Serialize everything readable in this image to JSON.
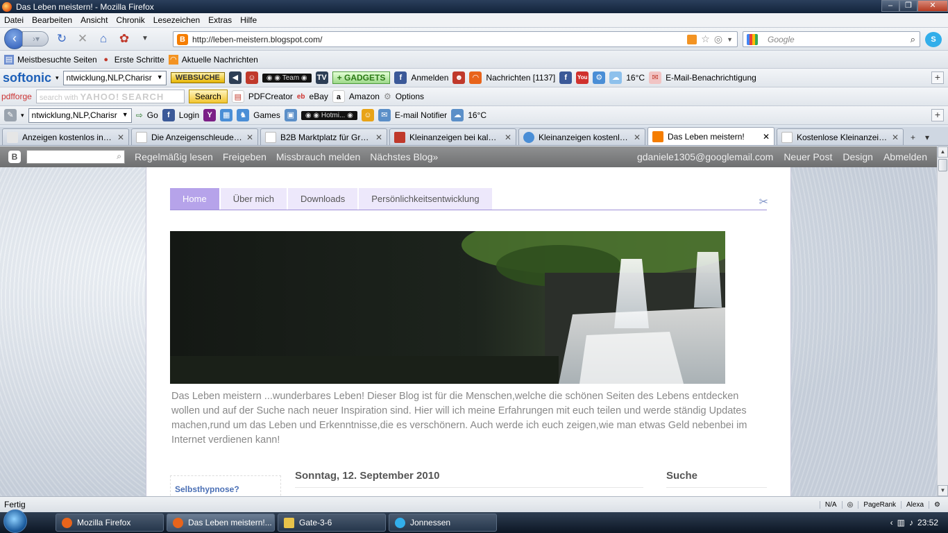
{
  "window": {
    "title": "Das Leben meistern! - Mozilla Firefox"
  },
  "menu": [
    "Datei",
    "Bearbeiten",
    "Ansicht",
    "Chronik",
    "Lesezeichen",
    "Extras",
    "Hilfe"
  ],
  "address": {
    "url": "http://leben-meistern.blogspot.com/"
  },
  "search": {
    "placeholder": "Google"
  },
  "bookmarks": [
    "Meistbesuchte Seiten",
    "Erste Schritte",
    "Aktuelle Nachrichten"
  ],
  "toolbar1": {
    "brand": "softonic",
    "combo": "ntwicklung,NLP,Charisr",
    "websuche": "WEBSUCHE",
    "player_label": "Team",
    "gadgets": "GADGETS",
    "anmelden": "Anmelden",
    "nachrichten": "Nachrichten [1137]",
    "temp": "16°C",
    "email": "E-Mail-Benachrichtigung"
  },
  "toolbar2": {
    "brand": "pdfforge",
    "yahoo_prefix": "search with",
    "yahoo_logo": "YAHOO!",
    "yahoo_search": "SEARCH",
    "search_btn": "Search",
    "pdfcreator": "PDFCreator",
    "ebay": "eBay",
    "amazon": "Amazon",
    "options": "Options"
  },
  "toolbar3": {
    "combo": "ntwicklung,NLP,Charisr",
    "go": "Go",
    "login": "Login",
    "games": "Games",
    "player_label": "Hotmi...",
    "email_notifier": "E-mail Notifier",
    "temp": "16°C"
  },
  "tabs": [
    {
      "label": "Anzeigen kostenlos inse...",
      "active": false
    },
    {
      "label": "Die Anzeigenschleuder ...",
      "active": false
    },
    {
      "label": "B2B Marktplatz für Groß...",
      "active": false
    },
    {
      "label": "Kleinanzeigen bei kalay...",
      "active": false
    },
    {
      "label": "Kleinanzeigen kostenlos...",
      "active": false
    },
    {
      "label": "Das Leben meistern!",
      "active": true
    },
    {
      "label": "Kostenlose Kleinanzeige...",
      "active": false
    }
  ],
  "blogger": {
    "links": [
      "Regelmäßig lesen",
      "Freigeben",
      "Missbrauch melden",
      "Nächstes Blog»"
    ],
    "user": "gdaniele1305@googlemail.com",
    "right_links": [
      "Neuer Post",
      "Design",
      "Abmelden"
    ]
  },
  "blog": {
    "nav": [
      "Home",
      "Über mich",
      "Downloads",
      "Persönlichkeitsentwicklung"
    ],
    "description": "Das Leben meistern ...wunderbares Leben! Dieser Blog ist für die Menschen,welche die schönen Seiten des Lebens entdecken wollen und auf der Suche nach neuer Inspiration sind. Hier will ich meine Erfahrungen mit euch teilen und werde ständig Updates machen,rund um das Leben und Erkenntnisse,die es verschönern. Auch werde ich euch zeigen,wie man etwas Geld nebenbei im Internet verdienen kann!",
    "sidebar_link": "Selbsthypnose?",
    "post_date": "Sonntag, 12. September 2010",
    "side_title": "Suche"
  },
  "status": {
    "text": "Fertig",
    "na": "N/A",
    "pagerank": "PageRank",
    "alexa": "Alexa"
  },
  "taskbar": {
    "items": [
      {
        "label": "Mozilla Firefox",
        "active": false
      },
      {
        "label": "Das Leben meistern!...",
        "active": true
      },
      {
        "label": "Gate-3-6",
        "active": false
      },
      {
        "label": "Jonnessen",
        "active": false
      }
    ],
    "clock": "23:52"
  }
}
